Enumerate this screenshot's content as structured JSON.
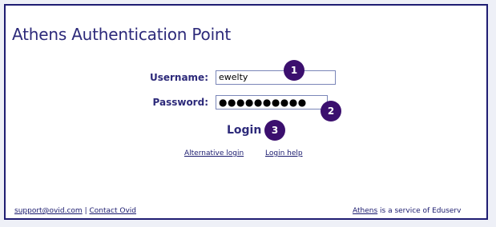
{
  "title": "Athens Authentication Point",
  "form": {
    "username_label": "Username:",
    "username_value": "ewelty",
    "password_label": "Password:",
    "password_value": "●●●●●●●●●●",
    "login_label": "Login"
  },
  "badges": {
    "one": "1",
    "two": "2",
    "three": "3"
  },
  "links": {
    "alternative_login": "Alternative login",
    "login_help": "Login help"
  },
  "footer": {
    "support_email": "support@ovid.com",
    "separator": "|",
    "contact": "Contact Ovid",
    "athens_link": "Athens",
    "service_text": " is a service of Eduserv"
  },
  "colors": {
    "frame": "#1f1d72",
    "text": "#2d2a7a",
    "badge": "#3b0f6e",
    "link": "#1a1a6e"
  }
}
